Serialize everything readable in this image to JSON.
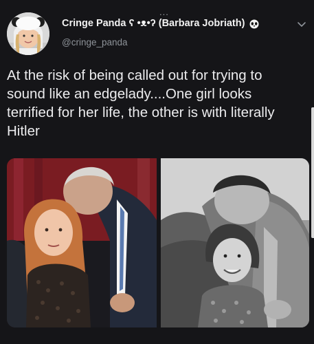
{
  "tweet": {
    "author": {
      "display_name": "Cringe Panda ʕ •ᴥ•ʔ (Barbara Jobriath)",
      "handle": "@cringe_panda"
    },
    "more_label": "...",
    "text": "At the risk of being called out for trying to sound like an edgelady....One girl looks terrified for her life, the other is with literally Hitler"
  },
  "colors": {
    "background": "#151518",
    "text": "#ececee",
    "muted": "#8e9399"
  },
  "icons": [
    "panda-emoji-icon",
    "chevron-down-icon"
  ]
}
